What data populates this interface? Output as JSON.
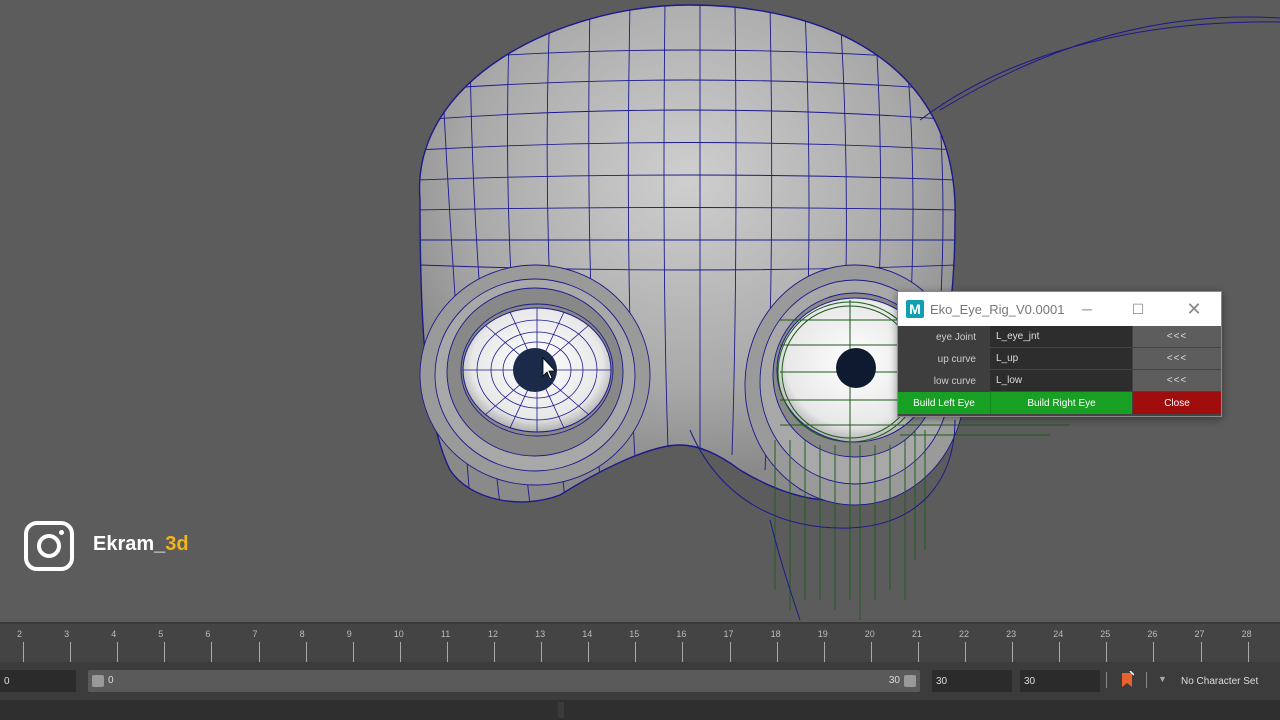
{
  "dialog": {
    "logo": "M",
    "title": "Eko_Eye_Rig_V0.0001",
    "minimize_icon": "─",
    "maximize_icon": "☐",
    "close_icon": "✕",
    "rows": [
      {
        "label": "eye Joint",
        "value": "L_eye_jnt",
        "button": "<<<"
      },
      {
        "label": "up curve",
        "value": "L_up",
        "button": "<<<"
      },
      {
        "label": "low curve",
        "value": "L_low",
        "button": "<<<"
      }
    ],
    "actions": {
      "build_left": "Build Left Eye",
      "build_right": "Build Right Eye",
      "close": "Close"
    }
  },
  "watermark": {
    "name_prefix": "Ekram_",
    "name_suffix": "3d",
    "icon": "instagram-icon"
  },
  "timeline": {
    "ticks": [
      "2",
      "3",
      "4",
      "5",
      "6",
      "7",
      "8",
      "9",
      "10",
      "11",
      "12",
      "13",
      "14",
      "15",
      "16",
      "17",
      "18",
      "19",
      "20",
      "21",
      "22",
      "23",
      "24",
      "25",
      "26",
      "27",
      "28"
    ]
  },
  "range": {
    "start_field": "0",
    "slider_start": "0",
    "slider_end": "30",
    "end_field_1": "30",
    "end_field_2": "30",
    "character_set": "No Character Set"
  },
  "colors": {
    "build_green": "#18a024",
    "close_red": "#a00d0d",
    "wire_blue": "#1a1a8c",
    "watermark_accent": "#f2b418"
  }
}
